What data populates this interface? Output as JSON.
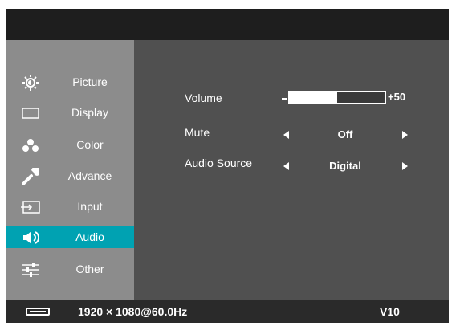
{
  "sidebar": {
    "items": [
      {
        "label": "Picture",
        "icon": "brightness-icon"
      },
      {
        "label": "Display",
        "icon": "display-icon"
      },
      {
        "label": "Color",
        "icon": "color-icon"
      },
      {
        "label": "Advance",
        "icon": "wrench-icon"
      },
      {
        "label": "Input",
        "icon": "input-icon"
      },
      {
        "label": "Audio",
        "icon": "speaker-icon",
        "selected": true
      },
      {
        "label": "Other",
        "icon": "sliders-icon"
      }
    ]
  },
  "audio": {
    "volume": {
      "label": "Volume",
      "value_text": "+50",
      "level_fraction": 0.5
    },
    "mute": {
      "label": "Mute",
      "value": "Off"
    },
    "source": {
      "label": "Audio Source",
      "value": "Digital"
    }
  },
  "status": {
    "resolution": "1920 × 1080@60.0Hz",
    "version": "V10"
  },
  "colors": {
    "accent": "#00a2b2",
    "sidebar": "#8c8c8c",
    "panel": "#505050"
  }
}
